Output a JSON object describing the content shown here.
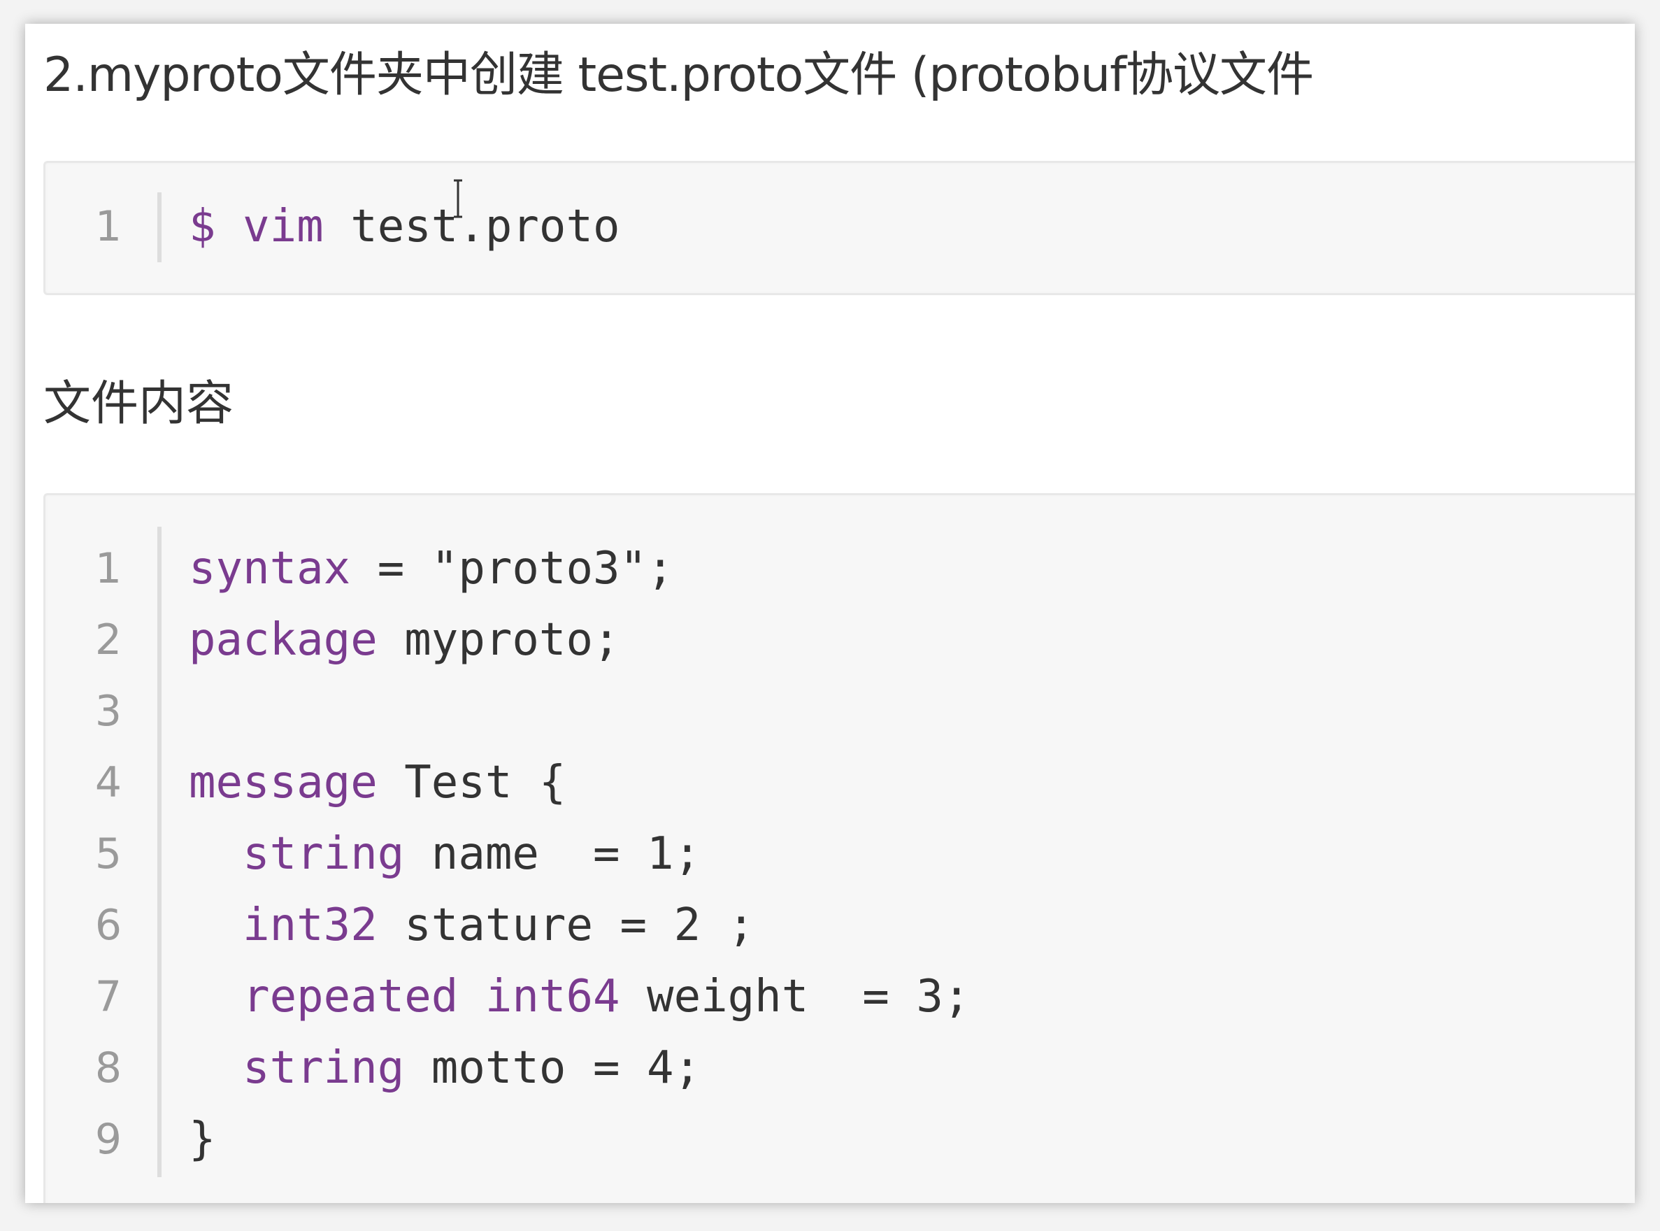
{
  "heading": "2.myproto文件夹中创建 test.proto文件 (protobuf协议文件",
  "command_block": {
    "lines": [
      {
        "number": "1",
        "tokens": [
          {
            "type": "prompt",
            "text": "$"
          },
          {
            "type": "punct",
            "text": " "
          },
          {
            "type": "keyword",
            "text": "vim"
          },
          {
            "type": "ident",
            "text": " test.proto"
          }
        ]
      }
    ]
  },
  "subheading": "文件内容",
  "file_block": {
    "lines": [
      {
        "number": "1",
        "tokens": [
          {
            "type": "keyword",
            "text": "syntax"
          },
          {
            "type": "punct",
            "text": " = "
          },
          {
            "type": "string",
            "text": "\"proto3\""
          },
          {
            "type": "punct",
            "text": ";"
          }
        ]
      },
      {
        "number": "2",
        "tokens": [
          {
            "type": "keyword",
            "text": "package"
          },
          {
            "type": "ident",
            "text": " myproto;"
          }
        ]
      },
      {
        "number": "3",
        "tokens": []
      },
      {
        "number": "4",
        "tokens": [
          {
            "type": "keyword",
            "text": "message"
          },
          {
            "type": "ident",
            "text": " Test {"
          }
        ]
      },
      {
        "number": "5",
        "tokens": [
          {
            "type": "punct",
            "text": "  "
          },
          {
            "type": "keyword",
            "text": "string"
          },
          {
            "type": "ident",
            "text": " name  = 1;"
          }
        ]
      },
      {
        "number": "6",
        "tokens": [
          {
            "type": "punct",
            "text": "  "
          },
          {
            "type": "keyword",
            "text": "int32"
          },
          {
            "type": "ident",
            "text": " stature = 2 ;"
          }
        ]
      },
      {
        "number": "7",
        "tokens": [
          {
            "type": "punct",
            "text": "  "
          },
          {
            "type": "keyword",
            "text": "repeated"
          },
          {
            "type": "punct",
            "text": " "
          },
          {
            "type": "keyword",
            "text": "int64"
          },
          {
            "type": "ident",
            "text": " weight  = 3;"
          }
        ]
      },
      {
        "number": "8",
        "tokens": [
          {
            "type": "punct",
            "text": "  "
          },
          {
            "type": "keyword",
            "text": "string"
          },
          {
            "type": "ident",
            "text": " motto = 4;"
          }
        ]
      },
      {
        "number": "9",
        "tokens": [
          {
            "type": "punct",
            "text": "}"
          }
        ]
      }
    ]
  },
  "colors": {
    "keyword": "#7a3b8f",
    "text": "#333333",
    "line_number": "#9a9a9a",
    "code_background": "#f7f7f7"
  }
}
